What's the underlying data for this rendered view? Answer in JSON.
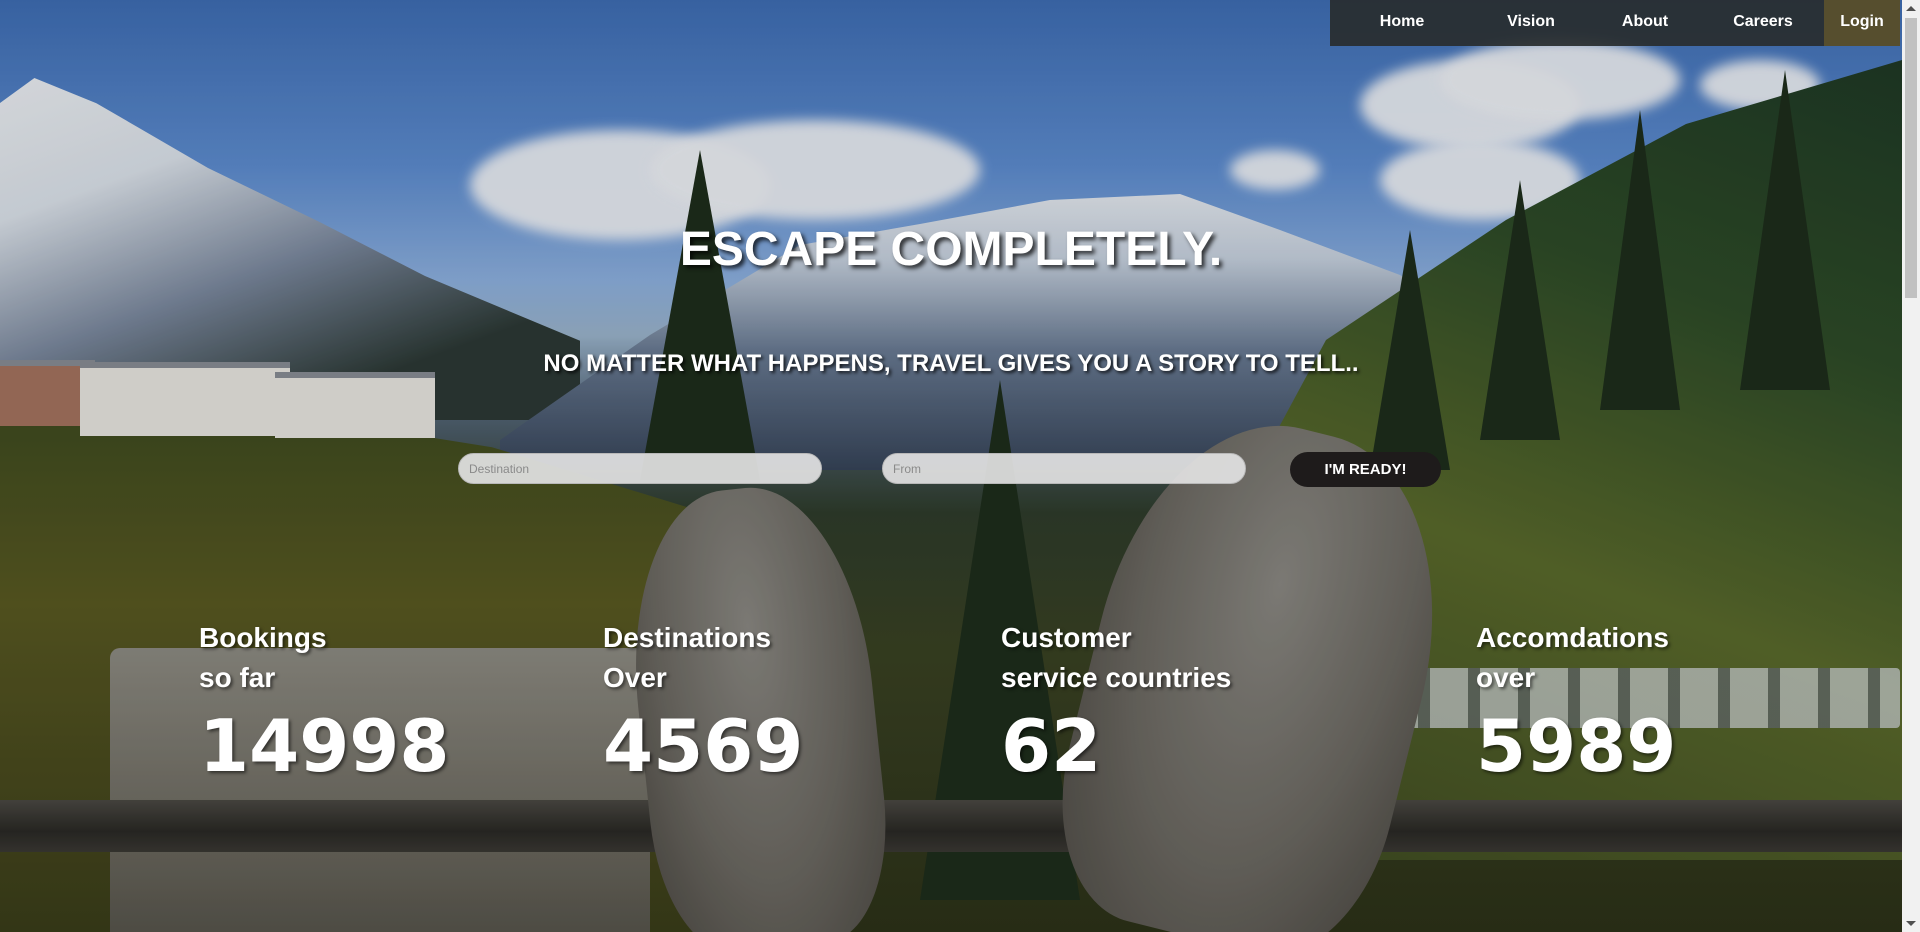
{
  "nav": {
    "items": [
      {
        "label": "Home"
      },
      {
        "label": "Vision"
      },
      {
        "label": "About"
      },
      {
        "label": "Careers"
      },
      {
        "label": "Login"
      }
    ]
  },
  "hero": {
    "title": "ESCAPE COMPLETELY.",
    "subtitle": "NO MATTER WHAT HAPPENS, TRAVEL GIVES YOU A STORY TO TELL.."
  },
  "search": {
    "destination_placeholder": "Destination",
    "from_placeholder": "From",
    "submit_label": "I'M READY!"
  },
  "stats": [
    {
      "line1": "Bookings",
      "line2": "so far",
      "value": "14998"
    },
    {
      "line1": "Destinations",
      "line2": "Over",
      "value": "4569"
    },
    {
      "line1": "Customer",
      "line2": "service countries",
      "value": "62"
    },
    {
      "line1": "Accomdations",
      "line2": "over",
      "value": "5989"
    }
  ]
}
